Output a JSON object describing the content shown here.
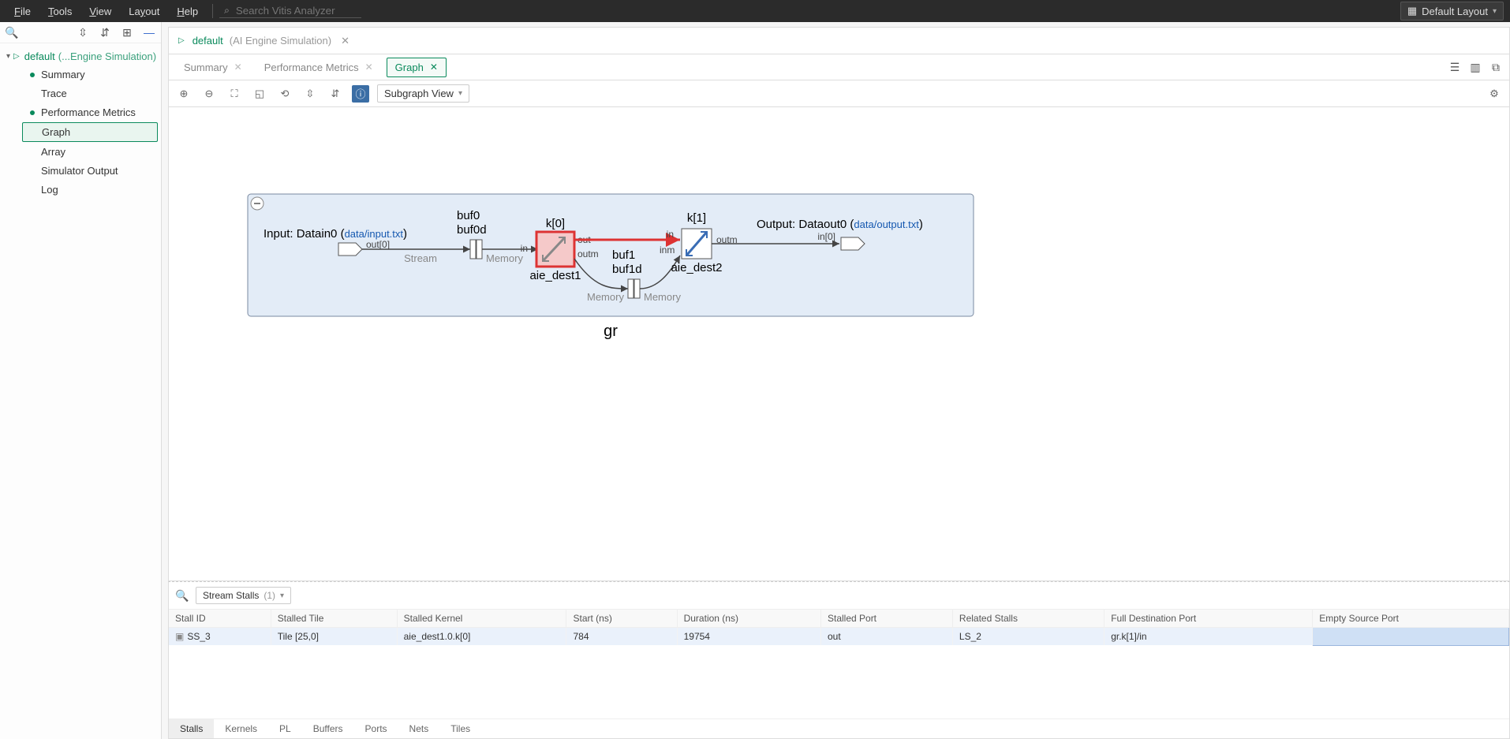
{
  "menubar": {
    "items": [
      "File",
      "Tools",
      "View",
      "Layout",
      "Help"
    ],
    "search_placeholder": "Search Vitis Analyzer",
    "layout_button": "Default Layout"
  },
  "sidebar": {
    "root": {
      "name": "default",
      "context": "(...Engine Simulation)"
    },
    "items": [
      {
        "label": "Summary",
        "dot": true
      },
      {
        "label": "Trace",
        "dot": false
      },
      {
        "label": "Performance Metrics",
        "dot": true
      },
      {
        "label": "Graph",
        "dot": false,
        "selected": true
      },
      {
        "label": "Array",
        "dot": false
      },
      {
        "label": "Simulator Output",
        "dot": false
      },
      {
        "label": "Log",
        "dot": false
      }
    ]
  },
  "breadcrumb": {
    "name": "default",
    "context": "(AI Engine Simulation)"
  },
  "sub_tabs": [
    {
      "label": "Summary",
      "active": false
    },
    {
      "label": "Performance Metrics",
      "active": false
    },
    {
      "label": "Graph",
      "active": true
    }
  ],
  "graph_toolbar": {
    "view_mode": "Subgraph View"
  },
  "graph": {
    "name": "gr",
    "input": {
      "label": "Input: Datain0",
      "file": "data/input.txt",
      "out_port": "out[0]"
    },
    "output": {
      "label": "Output: Dataout0",
      "file": "data/output.txt",
      "in_port": "in[0]"
    },
    "buf0": {
      "a": "buf0",
      "b": "buf0d"
    },
    "buf1": {
      "a": "buf1",
      "b": "buf1d"
    },
    "k0": {
      "title": "k[0]",
      "name": "aie_dest1",
      "selected": true,
      "ports": {
        "in": "in",
        "out_top": "out",
        "out_bot": "outm"
      }
    },
    "k1": {
      "title": "k[1]",
      "name": "aie_dest2",
      "ports": {
        "in_top": "in",
        "in_bot": "inm",
        "out": "outm"
      }
    },
    "edge_types": {
      "stream": "Stream",
      "memory": "Memory"
    }
  },
  "bottom": {
    "filter_label": "Stream Stalls",
    "filter_count": "(1)",
    "columns": [
      "Stall ID",
      "Stalled Tile",
      "Stalled Kernel",
      "Start (ns)",
      "Duration (ns)",
      "Stalled Port",
      "Related Stalls",
      "Full Destination Port",
      "Empty Source Port"
    ],
    "rows": [
      {
        "id": "SS_3",
        "tile": "Tile [25,0]",
        "kernel": "aie_dest1.0.k[0]",
        "start": "784",
        "duration": "19754",
        "port": "out",
        "related": "LS_2",
        "dest": "gr.k[1]/in",
        "src": ""
      }
    ],
    "tabs": [
      "Stalls",
      "Kernels",
      "PL",
      "Buffers",
      "Ports",
      "Nets",
      "Tiles"
    ],
    "active_tab": "Stalls"
  }
}
